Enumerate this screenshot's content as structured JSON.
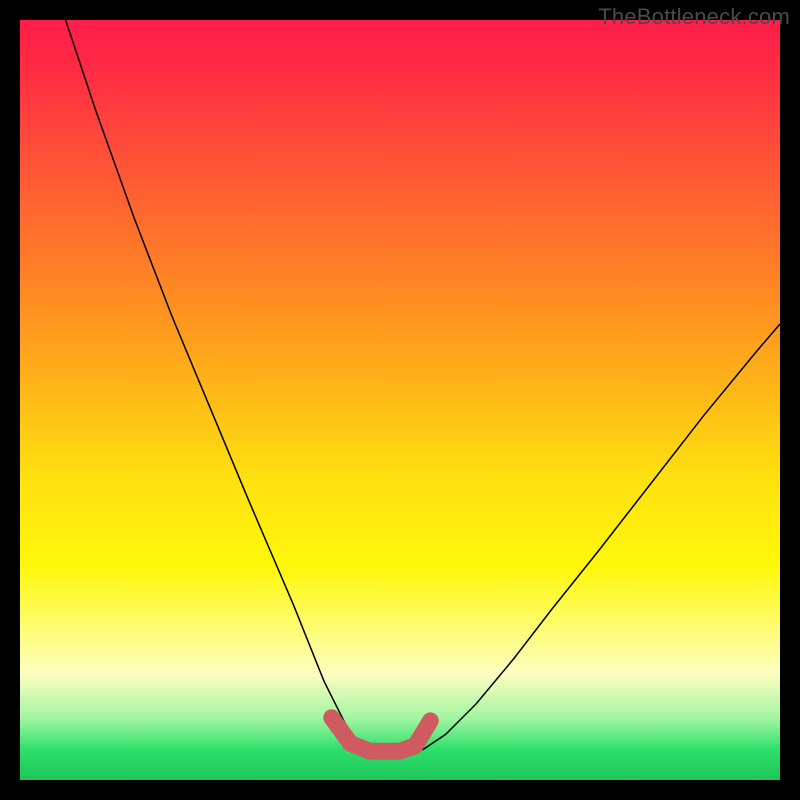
{
  "watermark": "TheBottleneck.com",
  "chart_data": {
    "type": "line",
    "title": "",
    "xlabel": "",
    "ylabel": "",
    "xlim": [
      0,
      1000
    ],
    "ylim": [
      0,
      1000
    ],
    "background": "rainbow-vertical-gradient",
    "series": [
      {
        "name": "curve",
        "stroke": "#000000",
        "stroke_width": 2,
        "x": [
          60,
          100,
          150,
          200,
          250,
          300,
          330,
          360,
          380,
          400,
          420,
          435,
          450,
          470,
          500,
          530,
          560,
          600,
          650,
          700,
          760,
          830,
          900,
          970,
          1000
        ],
        "y": [
          0,
          120,
          260,
          390,
          510,
          630,
          700,
          770,
          820,
          870,
          910,
          940,
          960,
          965,
          965,
          960,
          940,
          900,
          840,
          775,
          700,
          610,
          520,
          435,
          400
        ]
      },
      {
        "name": "valley-marker",
        "stroke": "#cf5a5f",
        "stroke_width": 22,
        "linecap": "round",
        "x": [
          410,
          435,
          460,
          500,
          520,
          540
        ],
        "y": [
          918,
          952,
          962,
          962,
          955,
          922
        ]
      }
    ]
  }
}
